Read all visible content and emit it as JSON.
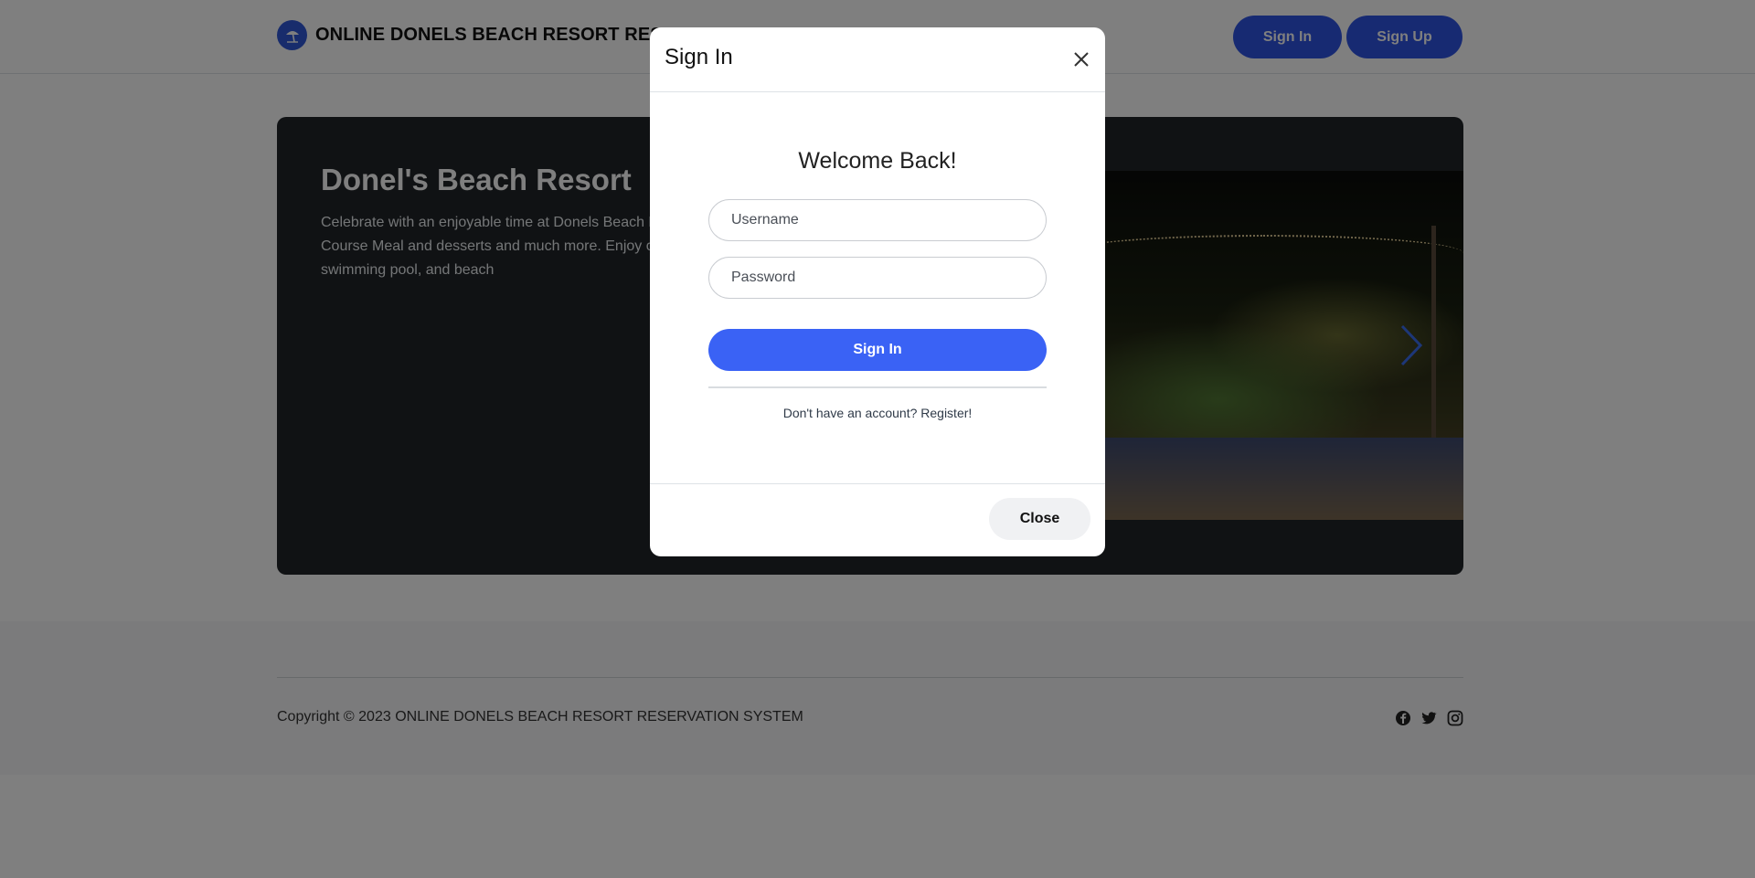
{
  "navbar": {
    "brand": "ONLINE DONELS BEACH RESORT RESERVATION SYSTEM",
    "brand_icon": "beach-umbrella-icon",
    "signin_label": "Sign In",
    "signup_label": "Sign Up",
    "accent": "#2f55e4"
  },
  "hero": {
    "title": "Donel's Beach Resort",
    "description": "Celebrate with an enjoyable time at Donels Beach Resort. Enjoy a Three Course Meal and desserts and much more. Enjoy our rooms, cottages, swimming pool, and beach",
    "next_icon": "chevron-right-icon"
  },
  "footer": {
    "copyright": "Copyright © 2023 ONLINE DONELS BEACH RESORT RESERVATION SYSTEM",
    "social": [
      "facebook-icon",
      "twitter-icon",
      "instagram-icon"
    ]
  },
  "modal": {
    "title": "Sign In",
    "welcome": "Welcome Back!",
    "username_placeholder": "Username",
    "password_placeholder": "Password",
    "submit_label": "Sign In",
    "register_text": "Don't have an account? Register!",
    "close_label": "Close",
    "submit_color": "#3a62f5"
  }
}
